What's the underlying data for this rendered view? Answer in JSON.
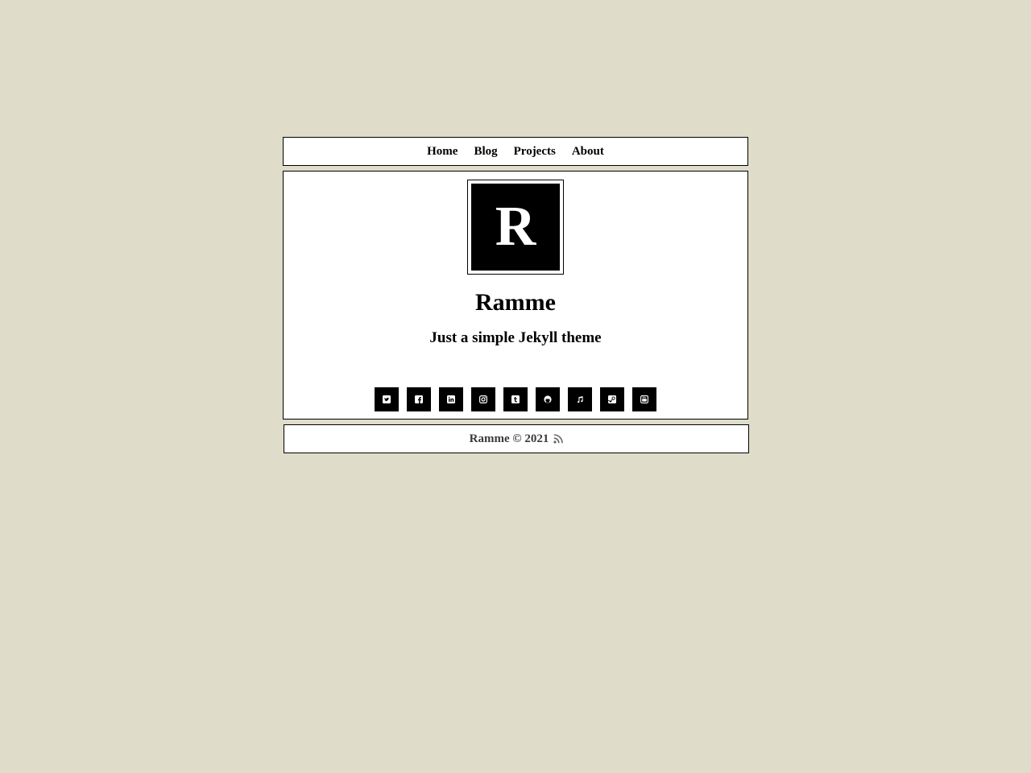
{
  "nav": {
    "items": [
      {
        "label": "Home"
      },
      {
        "label": "Blog"
      },
      {
        "label": "Projects"
      },
      {
        "label": "About"
      }
    ]
  },
  "header": {
    "logo_letter": "R",
    "title": "Ramme",
    "tagline": "Just a simple Jekyll theme"
  },
  "socials": [
    {
      "icon": "twitter-icon"
    },
    {
      "icon": "facebook-icon"
    },
    {
      "icon": "linkedin-icon"
    },
    {
      "icon": "instagram-icon"
    },
    {
      "icon": "tumblr-icon"
    },
    {
      "icon": "github-icon"
    },
    {
      "icon": "music-icon"
    },
    {
      "icon": "steam-icon"
    },
    {
      "icon": "youtube-icon"
    }
  ],
  "footer": {
    "text": "Ramme © 2021",
    "rss_icon": "rss-icon"
  },
  "colors": {
    "background": "#dfddca",
    "panel": "#ffffff",
    "ink": "#000000",
    "footer_text": "#3a3a3a"
  }
}
